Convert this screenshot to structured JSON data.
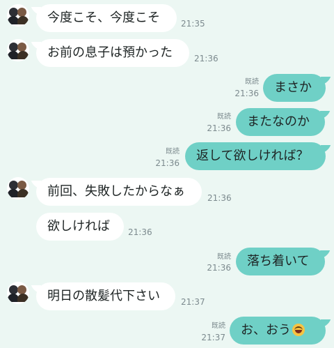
{
  "colors": {
    "background": "#ecf7f3",
    "incoming_bubble": "#ffffff",
    "outgoing_bubble": "#6fd0c6",
    "meta_text": "#7c8a8e"
  },
  "messages": [
    {
      "side": "in",
      "text": "今度こそ、今度こそ",
      "time": "21:35",
      "avatar": true
    },
    {
      "side": "in",
      "text": "お前の息子は預かった",
      "time": "21:36",
      "avatar": true
    },
    {
      "side": "out",
      "text": "まさか",
      "time": "21:36",
      "read": "既読"
    },
    {
      "side": "out",
      "text": "またなのか",
      "time": "21:36",
      "read": "既読"
    },
    {
      "side": "out",
      "text": "返して欲しければ？",
      "time": "21:36",
      "read": "既読"
    },
    {
      "side": "in",
      "text": "前回、失敗したからなぁ",
      "time": "21:36",
      "avatar": true
    },
    {
      "side": "in",
      "text": "欲しければ",
      "time": "21:36",
      "avatar": false
    },
    {
      "side": "out",
      "text": "落ち着いて",
      "time": "21:36",
      "read": "既読"
    },
    {
      "side": "in",
      "text": "明日の散髪代下さい",
      "time": "21:37",
      "avatar": true
    },
    {
      "side": "out",
      "text": "お、おう",
      "emoji": "face-with-tears-of-joy-icon",
      "time": "21:37",
      "read": "既読"
    }
  ]
}
